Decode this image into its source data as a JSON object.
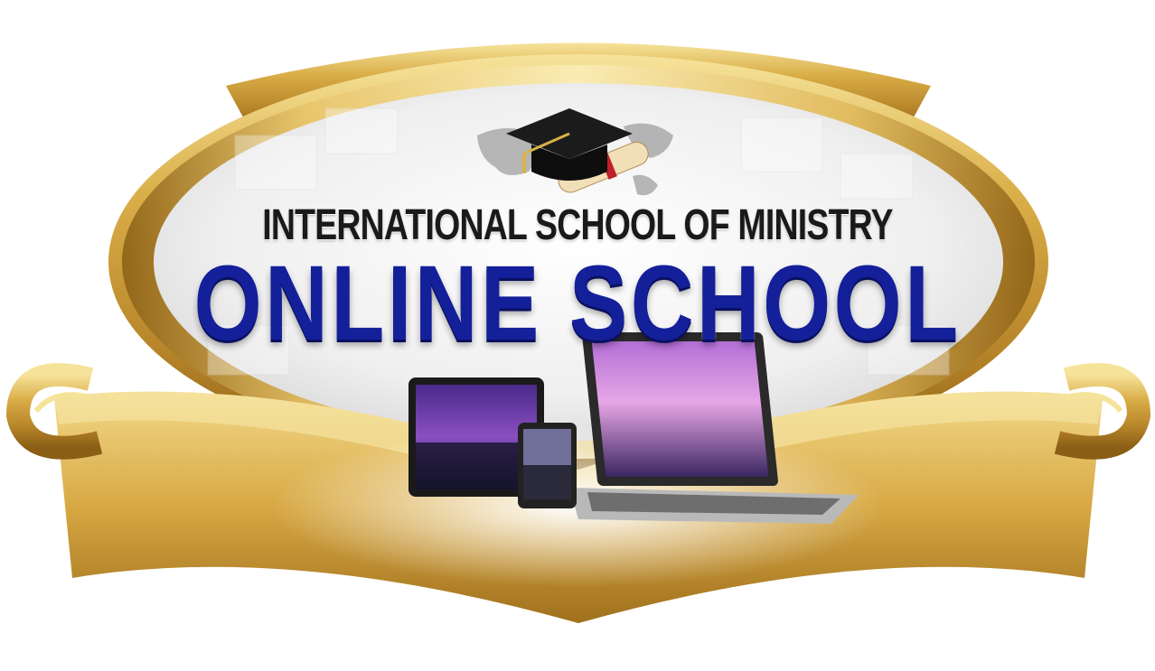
{
  "logo": {
    "subtitle": "INTERNATIONAL SCHOOL OF MINISTRY",
    "title": "ONLINE SCHOOL"
  },
  "colors": {
    "gold_light": "#f6e39a",
    "gold_mid": "#d4a640",
    "gold_dark": "#8a5e14",
    "title_blue": "#14209a",
    "subtitle_black": "#1a1a1a",
    "oval_bg": "#eeeeee"
  },
  "icons": [
    "graduation-cap-icon",
    "diploma-scroll-icon",
    "world-map-icon",
    "tablet-icon",
    "phone-icon",
    "laptop-icon"
  ]
}
